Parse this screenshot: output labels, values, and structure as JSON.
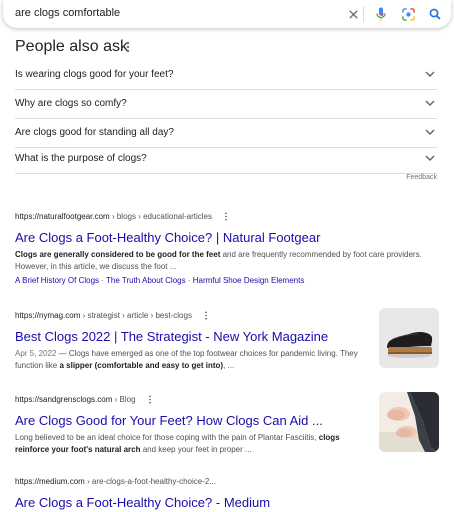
{
  "search": {
    "query": "are clogs comfortable"
  },
  "paa": {
    "title": "People also ask",
    "questions": [
      "Is wearing clogs good for your feet?",
      "Why are clogs so comfy?",
      "Are clogs good for standing all day?",
      "What is the purpose of clogs?"
    ],
    "feedback": "Feedback"
  },
  "results": [
    {
      "site": "https://naturalfootgear.com",
      "path": " › blogs › educational-articles",
      "title": "Are Clogs a Foot-Healthy Choice? | Natural Footgear",
      "snippet_b1": "Clogs are generally considered to be good for the feet",
      "snippet_t1": " and are frequently recommended by foot care providers. However, in this article, we discuss the foot ...",
      "sitelink1": "A Brief History Of Clogs",
      "sitelink2": "The Truth About Clogs",
      "sitelink3": "Harmful Shoe Design Elements",
      "sep": " · "
    },
    {
      "site": "https://nymag.com",
      "path": " › strategist › article › best-clogs",
      "title": "Best Clogs 2022 | The Strategist - New York Magazine",
      "date": "Apr 5, 2022",
      "snippet_t1": " — Clogs have emerged as one of the top footwear choices for pandemic living. They function like ",
      "snippet_b1": "a slipper (comfortable and easy to get into)",
      "snippet_t2": ", ..."
    },
    {
      "site": "https://sandgrensclogs.com",
      "path": " › Blog",
      "title": "Are Clogs Good for Your Feet? How Clogs Can Aid ...",
      "snippet_t1": "Long believed to be an ideal choice for those coping with the pain of Plantar Fasciitis, ",
      "snippet_b1": "clogs reinforce your foot's natural arch",
      "snippet_t2": " and keep your feet in proper ..."
    },
    {
      "site": "https://medium.com",
      "path": " › are-clogs-a-foot-healthy-choice-2...",
      "title": "Are Clogs a Foot-Healthy Choice? - Medium"
    }
  ],
  "colors": {
    "link": "#1a0dab",
    "text": "#202124",
    "muted": "#4d5156",
    "accent": "#1a73e8"
  },
  "icons": [
    "close-icon",
    "mic-icon",
    "camera-lens-icon",
    "search-icon",
    "more-vert-icon",
    "chevron-down-icon"
  ]
}
